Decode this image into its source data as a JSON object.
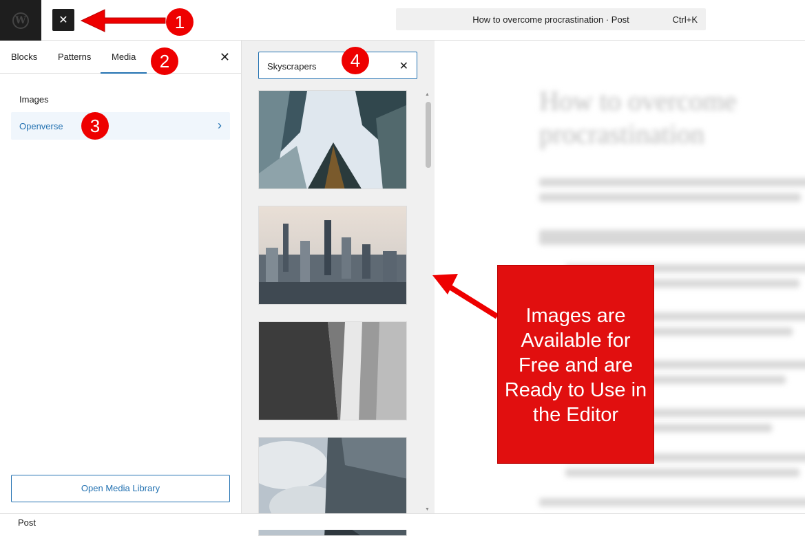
{
  "topbar": {
    "logo_icon": "wordpress-icon",
    "close_icon": "close-icon",
    "close_glyph": "✕",
    "document_title": "How to overcome procrastination · Post",
    "shortcut": "Ctrl+K"
  },
  "inserter": {
    "tabs": [
      "Blocks",
      "Patterns",
      "Media"
    ],
    "active_tab": "Media",
    "close_glyph": "✕",
    "categories": [
      "Images",
      "Openverse"
    ],
    "selected_category": "Openverse",
    "chevron_glyph": "›",
    "open_media_library": "Open Media Library"
  },
  "media": {
    "search_value": "Skyscrapers",
    "clear_glyph": "✕",
    "scroll_up": "▲",
    "scroll_down": "▼",
    "images": [
      "skyscrapers-looking-up",
      "city-skyline-aerial",
      "grayscale-building-corridor",
      "glass-tower-clouds"
    ]
  },
  "editor": {
    "title": "How to overcome procrastination"
  },
  "statusbar": {
    "breadcrumb": "Post"
  },
  "annotations": {
    "badges": [
      "1",
      "2",
      "3",
      "4"
    ],
    "callout_text": "Images are Available for Free and are Ready to Use in the Editor",
    "color": "#e10f0f"
  },
  "colors": {
    "accent": "#2271b1",
    "dark": "#1e1e1e",
    "panel_bg": "#f0f0f0"
  }
}
